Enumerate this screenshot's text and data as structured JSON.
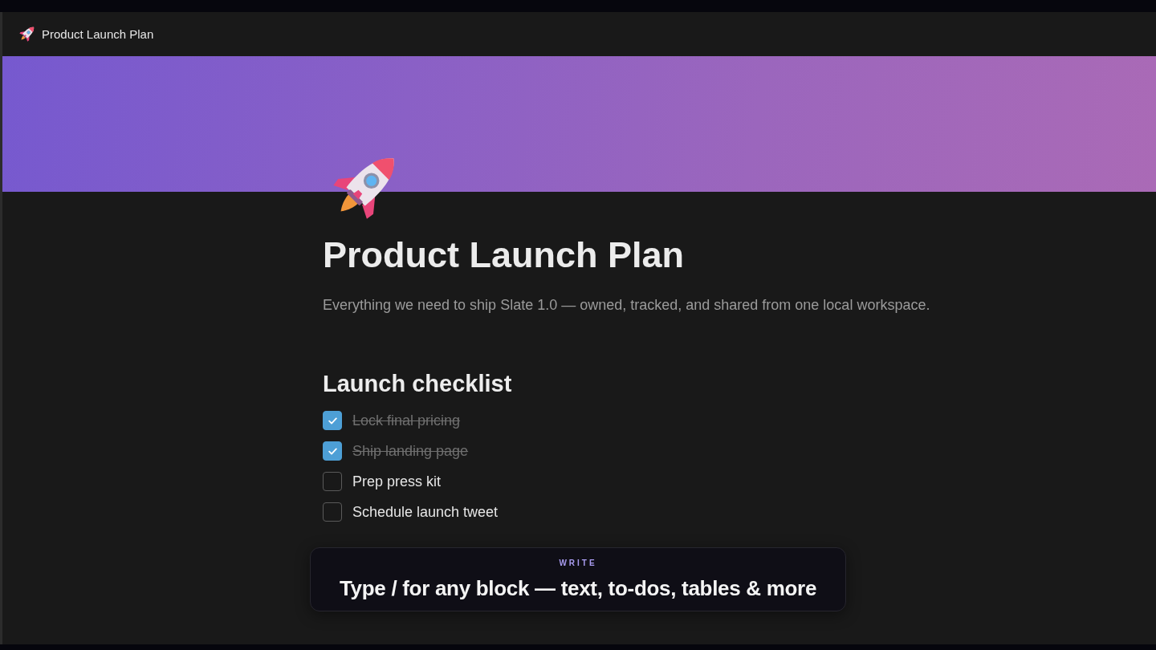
{
  "breadcrumb": {
    "title": "Product Launch Plan"
  },
  "page": {
    "title": "Product Launch Plan",
    "description": "Everything we need to ship Slate 1.0 — owned, tracked, and shared from one local workspace.",
    "blocks": [
      {
        "kind": "heading",
        "text": "Launch checklist"
      },
      {
        "kind": "todo",
        "text": "Lock final pricing",
        "checked": true
      },
      {
        "kind": "todo",
        "text": "Ship landing page",
        "checked": true
      },
      {
        "kind": "todo",
        "text": "Prep press kit",
        "checked": false
      },
      {
        "kind": "todo",
        "text": "Schedule launch tweet",
        "checked": false
      }
    ]
  },
  "caption": {
    "label": "WRITE",
    "text": "Type / for any block — text, to-dos, tables & more"
  }
}
